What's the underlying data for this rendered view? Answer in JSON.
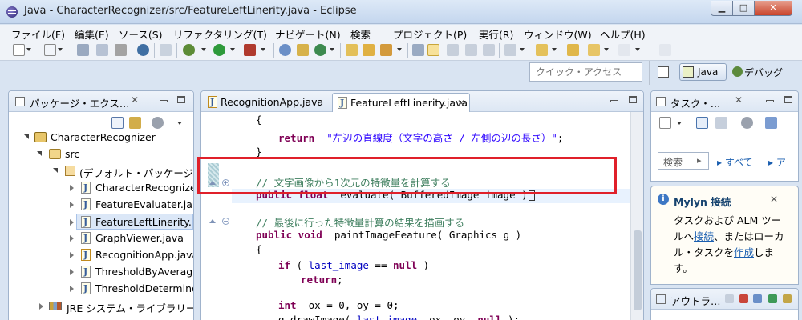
{
  "window": {
    "title": "Java - CharacterRecognizer/src/FeatureLeftLinerity.java - Eclipse"
  },
  "menu": [
    "ファイル(F)",
    "編集(E)",
    "ソース(S)",
    "リファクタリング(T)",
    "ナビゲート(N)",
    "検索",
    "プロジェクト(P)",
    "実行(R)",
    "ウィンドウ(W)",
    "ヘルプ(H)"
  ],
  "quick_access": {
    "placeholder": "クイック・アクセス"
  },
  "perspectives": {
    "java": "Java",
    "debug": "デバッグ"
  },
  "package_explorer": {
    "title": "パッケージ・エクス…",
    "tree": {
      "project": "CharacterRecognizer",
      "src": "src",
      "default_package": "(デフォルト・パッケージ",
      "files": [
        "CharacterRecognize",
        "FeatureEvaluater.ja",
        "FeatureLeftLinerity.",
        "GraphViewer.java",
        "RecognitionApp.java",
        "ThresholdByAverag",
        "ThresholdDetermine"
      ],
      "library": "JRE システム・ライブラリー"
    }
  },
  "editor": {
    "tabs": [
      "RecognitionApp.java",
      "FeatureLeftLinerity.java"
    ],
    "lines": {
      "l1": "{",
      "l2_kw": "return",
      "l2_str": "\"左辺の直線度（文字の高さ / 左側の辺の長さ）\"",
      "l2_end": ";",
      "l3": "}",
      "l5_comment": "// 文字画像から1次元の特徴量を計算する",
      "l6_kw": "public float",
      "l6_rest": "  evaluate( BufferedImage image )",
      "l8_comment": "// 最後に行った特徴量計算の結果を描画する",
      "l9_kw": "public void",
      "l9_rest": "  paintImageFeature( Graphics g )",
      "l10": "{",
      "l11_kw": "if",
      "l11_a": " ( ",
      "l11_fld": "last_image",
      "l11_b": " == ",
      "l11_kw2": "null",
      "l11_c": " )",
      "l12_kw": "return",
      "l12_end": ";",
      "l14_kw": "int",
      "l14_rest": "  ox = 0, oy = 0;",
      "l15_a": "g.drawImage( ",
      "l15_fld": "last_image",
      "l15_b": ", ox, oy, ",
      "l15_kw": "null",
      "l15_c": " );"
    }
  },
  "task_list": {
    "title": "タスク・…",
    "search": "検索",
    "all": "▸ すべて",
    "more": "▸ ア"
  },
  "mylyn": {
    "title": "Mylyn 接続",
    "text1": "タスクおよび ALM ツー",
    "text2a": "ルへ",
    "link_connect": "接続",
    "text2b": "、またはローカ",
    "text3a": "ル・タスクを",
    "link_create": "作成",
    "text3b": "しま",
    "text4": "す。"
  },
  "outline": {
    "title": "アウトラ…"
  },
  "colors": {
    "accent": "#e0202a",
    "keyword": "#7f0055",
    "string": "#2a00ff",
    "comment": "#3f7f5f"
  }
}
